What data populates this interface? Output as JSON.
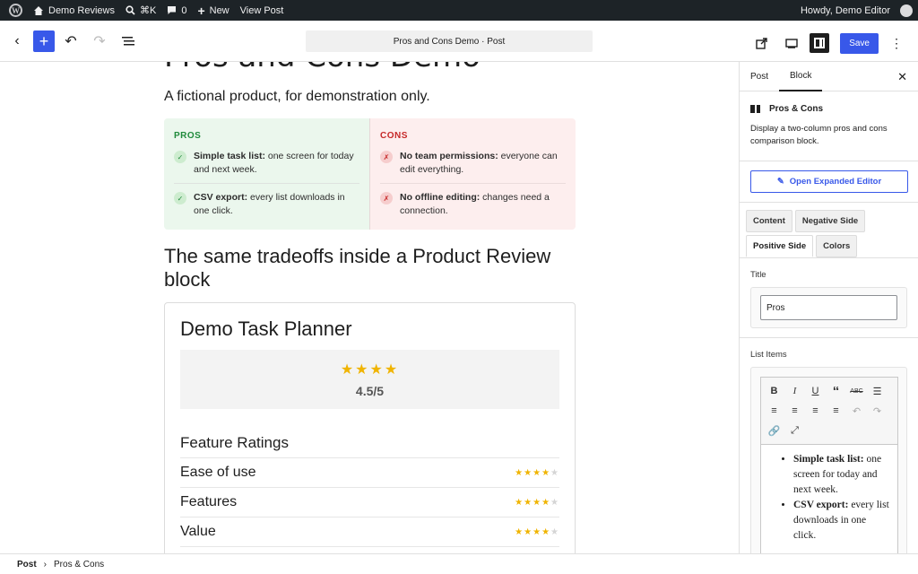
{
  "admin_bar": {
    "site_name": "Demo Reviews",
    "search_shortcut": "⌘K",
    "comments_count": "0",
    "new_label": "New",
    "view_post_label": "View Post",
    "greeting": "Howdy, Demo Editor"
  },
  "editor_toolbar": {
    "document_title": "Pros and Cons Demo · Post",
    "save_label": "Save"
  },
  "canvas": {
    "post_title": "Pros and Cons Demo",
    "intro": "A fictional product, for demonstration only.",
    "pros_cons": {
      "pros_heading": "PROS",
      "cons_heading": "CONS",
      "pros": [
        {
          "bold": "Simple task list:",
          "text": " one screen for today and next week."
        },
        {
          "bold": "CSV export:",
          "text": " every list downloads in one click."
        }
      ],
      "cons": [
        {
          "bold": "No team permissions:",
          "text": " everyone can edit everything."
        },
        {
          "bold": "No offline editing:",
          "text": " changes need a connection."
        }
      ]
    },
    "section_heading": "The same tradeoffs inside a Product Review block",
    "review": {
      "product_name": "Demo Task Planner",
      "overall_rating": 4.5,
      "overall_label": "4.5/5",
      "feature_ratings_heading": "Feature Ratings",
      "features": [
        {
          "label": "Ease of use",
          "rating": 4
        },
        {
          "label": "Features",
          "rating": 4
        },
        {
          "label": "Value",
          "rating": 4
        }
      ]
    }
  },
  "sidebar": {
    "tabs": [
      "Post",
      "Block"
    ],
    "active_tab": "Block",
    "block_name": "Pros & Cons",
    "block_description": "Display a two-column pros and cons comparison block.",
    "expanded_editor_label": "Open Expanded Editor",
    "settings_tabs": [
      "Content",
      "Negative Side",
      "Positive Side",
      "Colors"
    ],
    "active_settings_tab": "Positive Side",
    "title_label": "Title",
    "title_value": "Pros",
    "list_items_label": "List Items",
    "list_items": [
      {
        "bold": "Simple task list:",
        "text": " one screen for today and next week."
      },
      {
        "bold": "CSV export:",
        "text": " every list downloads in one click."
      }
    ]
  },
  "footer": {
    "breadcrumb": [
      "Post",
      "Pros & Cons"
    ]
  },
  "colors": {
    "accent": "#3858e9",
    "pros_bg": "#ebf7ed",
    "cons_bg": "#fdeeee",
    "star": "#f0b400"
  }
}
